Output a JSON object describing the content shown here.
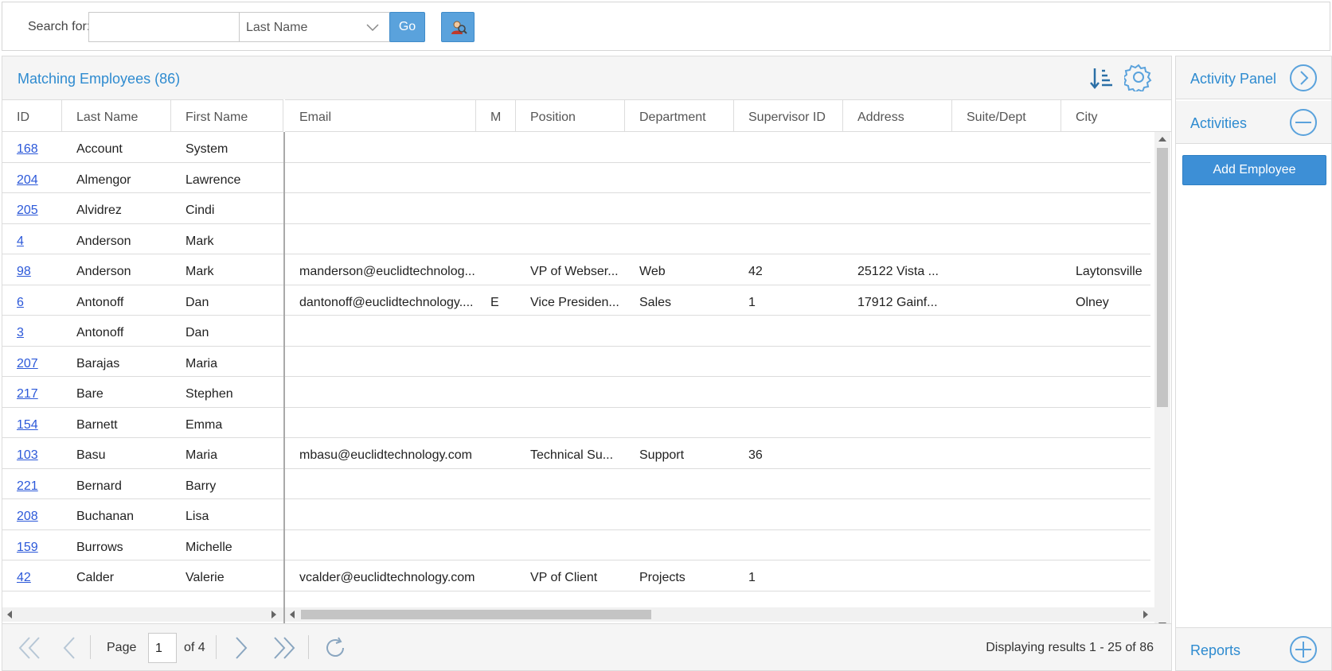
{
  "search": {
    "label": "Search for:",
    "value": "",
    "placeholder": "",
    "field_selected": "Last Name",
    "go_label": "Go"
  },
  "grid": {
    "title": "Matching Employees (86)",
    "columns": [
      "ID",
      "Last Name",
      "First Name",
      "Email",
      "M",
      "Position",
      "Department",
      "Supervisor ID",
      "Address",
      "Suite/Dept",
      "City"
    ],
    "rows": [
      {
        "id": "168",
        "last": "Account",
        "first": "System",
        "email": "",
        "m": "",
        "position": "",
        "department": "",
        "supervisor": "",
        "address": "",
        "suite": "",
        "city": ""
      },
      {
        "id": "204",
        "last": "Almengor",
        "first": "Lawrence",
        "email": "",
        "m": "",
        "position": "",
        "department": "",
        "supervisor": "",
        "address": "",
        "suite": "",
        "city": ""
      },
      {
        "id": "205",
        "last": "Alvidrez",
        "first": "Cindi",
        "email": "",
        "m": "",
        "position": "",
        "department": "",
        "supervisor": "",
        "address": "",
        "suite": "",
        "city": ""
      },
      {
        "id": "4",
        "last": "Anderson",
        "first": "Mark",
        "email": "",
        "m": "",
        "position": "",
        "department": "",
        "supervisor": "",
        "address": "",
        "suite": "",
        "city": ""
      },
      {
        "id": "98",
        "last": "Anderson",
        "first": "Mark",
        "email": "manderson@euclidtechnolog...",
        "m": "",
        "position": "VP of Webser...",
        "department": "Web",
        "supervisor": "42",
        "address": "25122 Vista ...",
        "suite": "",
        "city": "Laytonsville"
      },
      {
        "id": "6",
        "last": "Antonoff",
        "first": "Dan",
        "email": "dantonoff@euclidtechnology....",
        "m": "E",
        "position": "Vice Presiden...",
        "department": "Sales",
        "supervisor": "1",
        "address": "17912 Gainf...",
        "suite": "",
        "city": "Olney"
      },
      {
        "id": "3",
        "last": "Antonoff",
        "first": "Dan",
        "email": "",
        "m": "",
        "position": "",
        "department": "",
        "supervisor": "",
        "address": "",
        "suite": "",
        "city": ""
      },
      {
        "id": "207",
        "last": "Barajas",
        "first": "Maria",
        "email": "",
        "m": "",
        "position": "",
        "department": "",
        "supervisor": "",
        "address": "",
        "suite": "",
        "city": ""
      },
      {
        "id": "217",
        "last": "Bare",
        "first": "Stephen",
        "email": "",
        "m": "",
        "position": "",
        "department": "",
        "supervisor": "",
        "address": "",
        "suite": "",
        "city": ""
      },
      {
        "id": "154",
        "last": "Barnett",
        "first": "Emma",
        "email": "",
        "m": "",
        "position": "",
        "department": "",
        "supervisor": "",
        "address": "",
        "suite": "",
        "city": ""
      },
      {
        "id": "103",
        "last": "Basu",
        "first": "Maria",
        "email": "mbasu@euclidtechnology.com",
        "m": "",
        "position": "Technical Su...",
        "department": "Support",
        "supervisor": "36",
        "address": "",
        "suite": "",
        "city": ""
      },
      {
        "id": "221",
        "last": "Bernard",
        "first": "Barry",
        "email": "",
        "m": "",
        "position": "",
        "department": "",
        "supervisor": "",
        "address": "",
        "suite": "",
        "city": ""
      },
      {
        "id": "208",
        "last": "Buchanan",
        "first": "Lisa",
        "email": "",
        "m": "",
        "position": "",
        "department": "",
        "supervisor": "",
        "address": "",
        "suite": "",
        "city": ""
      },
      {
        "id": "159",
        "last": "Burrows",
        "first": "Michelle",
        "email": "",
        "m": "",
        "position": "",
        "department": "",
        "supervisor": "",
        "address": "",
        "suite": "",
        "city": ""
      },
      {
        "id": "42",
        "last": "Calder",
        "first": "Valerie",
        "email": "vcalder@euclidtechnology.com",
        "m": "",
        "position": "VP of Client",
        "department": "Projects",
        "supervisor": "1",
        "address": "",
        "suite": "",
        "city": ""
      }
    ]
  },
  "pager": {
    "page_label": "Page",
    "current_page": "1",
    "of_label": "of 4",
    "display_info": "Displaying results 1 - 25 of 86"
  },
  "panel": {
    "activity_panel_label": "Activity Panel",
    "activities_label": "Activities",
    "add_employee_label": "Add Employee",
    "reports_label": "Reports"
  },
  "colors": {
    "accent": "#2e8bd0",
    "button": "#5aa2dc",
    "link": "#2b58d9"
  }
}
